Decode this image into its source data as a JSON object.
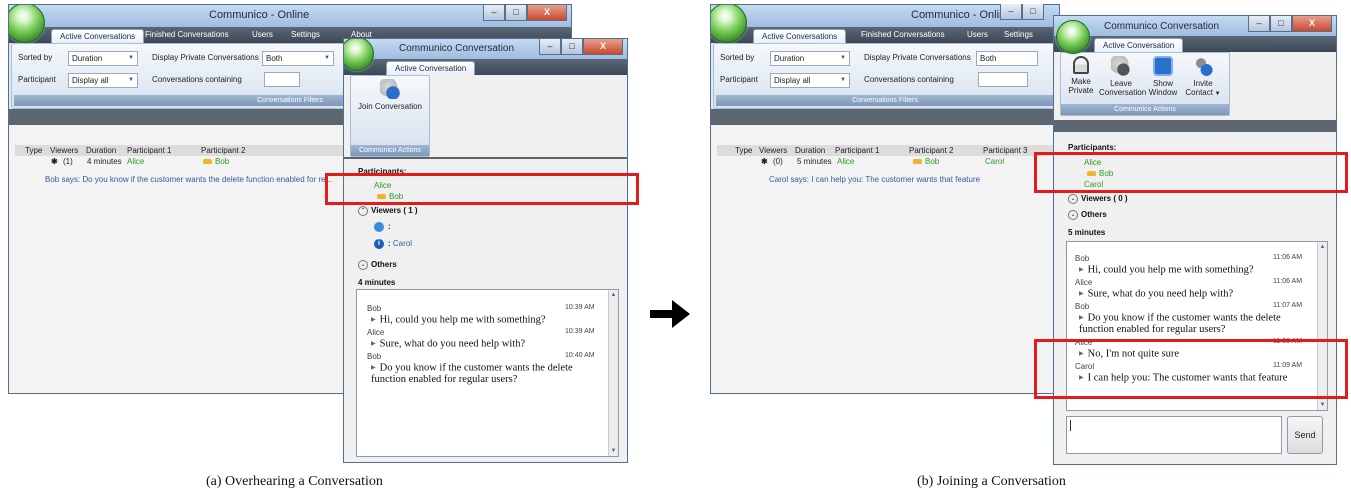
{
  "left": {
    "main_window": {
      "title": "Communico - Online",
      "menu": [
        "Active Conversations",
        "Finished Conversations",
        "Users",
        "Settings",
        "About"
      ],
      "filters": {
        "sorted_by_label": "Sorted by",
        "sorted_by_value": "Duration",
        "display_private_label": "Display Private Conversations",
        "display_private_value": "Both",
        "participant_label": "Participant",
        "participant_value": "Display all",
        "conversations_containing_label": "Conversations containing",
        "group_label": "Conversations Filters"
      },
      "table": {
        "headers": [
          "Type",
          "Viewers",
          "Duration",
          "Participant 1",
          "Participant 2"
        ],
        "row": {
          "viewers": "(1)",
          "duration": "4 minutes",
          "p1": "Alice",
          "p2": "Bob"
        },
        "preview": "Bob says: Do you know if the customer wants the delete function enabled for re..."
      }
    },
    "conv_window": {
      "title": "Communico Conversation",
      "tab": "Active Conversation",
      "join_button": "Join Conversation",
      "group_label": "Communico Actions",
      "participants_label": "Participants:",
      "participants": [
        "Alice",
        "Bob"
      ],
      "viewers_label": "Viewers ( 1 )",
      "viewer_colon": ":",
      "viewer_name": "Carol",
      "others_label": "Others",
      "duration": "4 minutes",
      "messages": [
        {
          "author": "Bob",
          "time": "10:39 AM",
          "text": "Hi, could you help me with something?"
        },
        {
          "author": "Alice",
          "time": "10:39 AM",
          "text": "Sure, what do you need help with?"
        },
        {
          "author": "Bob",
          "time": "10:40 AM",
          "text": "Do you know if the customer wants the delete function enabled for regular users?"
        }
      ]
    },
    "caption": "(a) Overhearing a Conversation"
  },
  "right": {
    "main_window": {
      "title": "Communico - Online",
      "menu": [
        "Active Conversations",
        "Finished Conversations",
        "Users",
        "Settings"
      ],
      "filters": {
        "sorted_by_label": "Sorted by",
        "sorted_by_value": "Duration",
        "display_private_label": "Display Private Conversations",
        "display_private_value": "Both",
        "participant_label": "Participant",
        "participant_value": "Display all",
        "conversations_containing_label": "Conversations containing",
        "group_label": "Conversations Filters"
      },
      "table": {
        "headers": [
          "Type",
          "Viewers",
          "Duration",
          "Participant 1",
          "Participant 2",
          "Participant 3"
        ],
        "row": {
          "viewers": "(0)",
          "duration": "5 minutes",
          "p1": "Alice",
          "p2": "Bob",
          "p3": "Carol"
        },
        "preview": "Carol says: I can help you: The customer wants that feature"
      }
    },
    "conv_window": {
      "title": "Communico Conversation",
      "tab": "Active Conversation",
      "buttons": [
        "Make Private",
        "Leave Conversation",
        "Show Window",
        "Invite Contact"
      ],
      "group_label": "Communico Actions",
      "participants_label": "Participants:",
      "participants": [
        "Alice",
        "Bob",
        "Carol"
      ],
      "viewers_label": "Viewers ( 0 )",
      "others_label": "Others",
      "duration": "5 minutes",
      "messages": [
        {
          "author": "Bob",
          "time": "11:06 AM",
          "text": "Hi, could you help me with something?"
        },
        {
          "author": "Alice",
          "time": "11:06 AM",
          "text": "Sure, what do you need help with?"
        },
        {
          "author": "Bob",
          "time": "11:07 AM",
          "text": "Do you know if the customer wants the delete function enabled for regular users?"
        },
        {
          "author": "Alice",
          "time": "11:08 AM",
          "text": "No, I'm not quite sure"
        },
        {
          "author": "Carol",
          "time": "11:09 AM",
          "text": "I can help you: The customer wants that feature"
        }
      ],
      "send_button": "Send"
    },
    "caption": "(b) Joining a Conversation"
  },
  "colors": {
    "highlight": "#e31b1b",
    "participant_green": "#2c9a25",
    "link_blue": "#2f5f9e",
    "arrow": "#000000"
  }
}
